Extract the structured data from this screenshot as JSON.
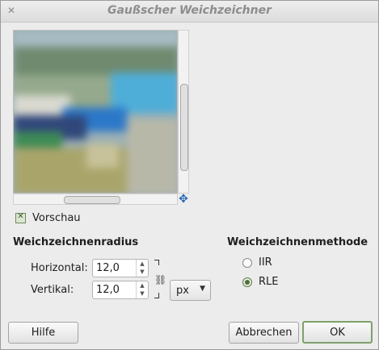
{
  "window": {
    "title": "Gaußscher Weichzeichner",
    "close_icon": "close-icon"
  },
  "preview": {
    "toggle_label": "Vorschau",
    "toggle_checked": true,
    "navigate_icon": "move-arrows-icon"
  },
  "radius": {
    "section_title": "Weichzeichnenradius",
    "horizontal_label": "Horizontal:",
    "horizontal_value": "12,0",
    "vertical_label": "Vertikal:",
    "vertical_value": "12,0",
    "chain_icon": "chain-link-icon",
    "unit": "px"
  },
  "method": {
    "section_title": "Weichzeichnenmethode",
    "options": [
      {
        "label": "IIR",
        "selected": false
      },
      {
        "label": "RLE",
        "selected": true
      }
    ]
  },
  "buttons": {
    "help": "Hilfe",
    "cancel": "Abbrechen",
    "ok": "OK"
  }
}
